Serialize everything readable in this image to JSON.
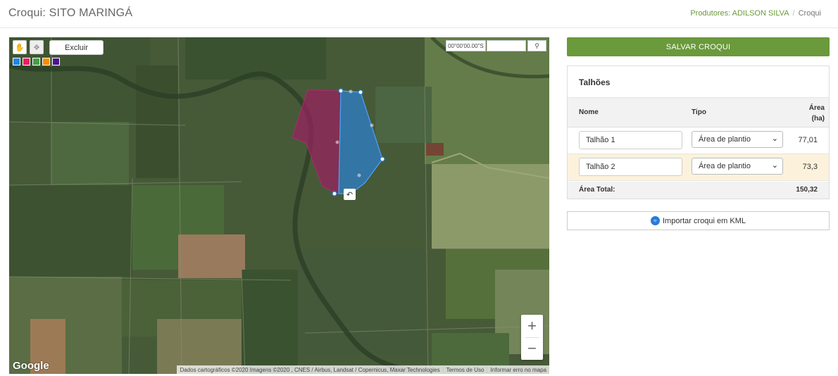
{
  "header": {
    "title": "Croqui: SITO MARINGÁ",
    "breadcrumb": {
      "link": "Produtores: ADILSON SILVA",
      "separator": "/",
      "current": "Croqui"
    }
  },
  "map": {
    "toolbar": {
      "pan_icon": "hand-icon",
      "draw_icon": "polygon-draw-icon",
      "delete_label": "Excluir"
    },
    "swatches": [
      "#1e88e5",
      "#e91e63",
      "#43a047",
      "#fb8c00",
      "#4a148c"
    ],
    "coordinate": "00°00'00.00\"S",
    "coordinate_field": "",
    "search_icon": "magnifier-icon",
    "polygon_colors": {
      "talhao1": "#2d7fd0",
      "talhao2": "#9a2060"
    },
    "undo_icon": "undo-icon",
    "zoom_in": "+",
    "zoom_out": "−",
    "logo": "Google",
    "attribution": "Dados cartográficos ©2020 Imagens ©2020 , CNES / Airbus, Landsat / Copernicus, Maxar Technologies",
    "terms": "Termos de Uso",
    "report": "Informar erro no mapa"
  },
  "panel": {
    "save_label": "SALVAR CROQUI",
    "heading": "Talhões",
    "columns": {
      "nome": "Nome",
      "tipo": "Tipo",
      "area_line1": "Área",
      "area_line2": "(ha)"
    },
    "rows": [
      {
        "nome": "Talhão 1",
        "tipo": "Área de plantio",
        "area": "77,01"
      },
      {
        "nome": "Talhão 2",
        "tipo": "Área de plantio",
        "area": "73,3"
      }
    ],
    "total_label": "Área Total:",
    "total_value": "150,32",
    "import_label": "Importar croqui em KML",
    "import_icon": "kml-globe-icon"
  }
}
